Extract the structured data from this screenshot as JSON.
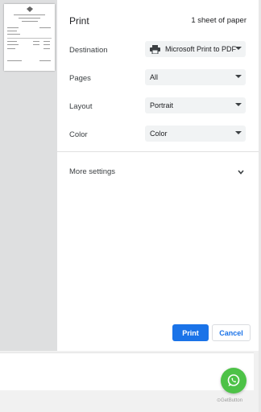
{
  "dialog": {
    "title": "Print",
    "sheet_count": "1 sheet of paper"
  },
  "settings": {
    "destination": {
      "label": "Destination",
      "value": "Microsoft Print to PDF",
      "icon": "printer-icon"
    },
    "pages": {
      "label": "Pages",
      "value": "All"
    },
    "layout": {
      "label": "Layout",
      "value": "Portrait"
    },
    "color": {
      "label": "Color",
      "value": "Color"
    },
    "more_settings": "More settings"
  },
  "buttons": {
    "print": "Print",
    "cancel": "Cancel"
  },
  "widget": {
    "icon": "whatsapp-icon",
    "credit": "GetButton"
  },
  "colors": {
    "accent": "#1a73e8",
    "whatsapp": "#4dc247"
  }
}
